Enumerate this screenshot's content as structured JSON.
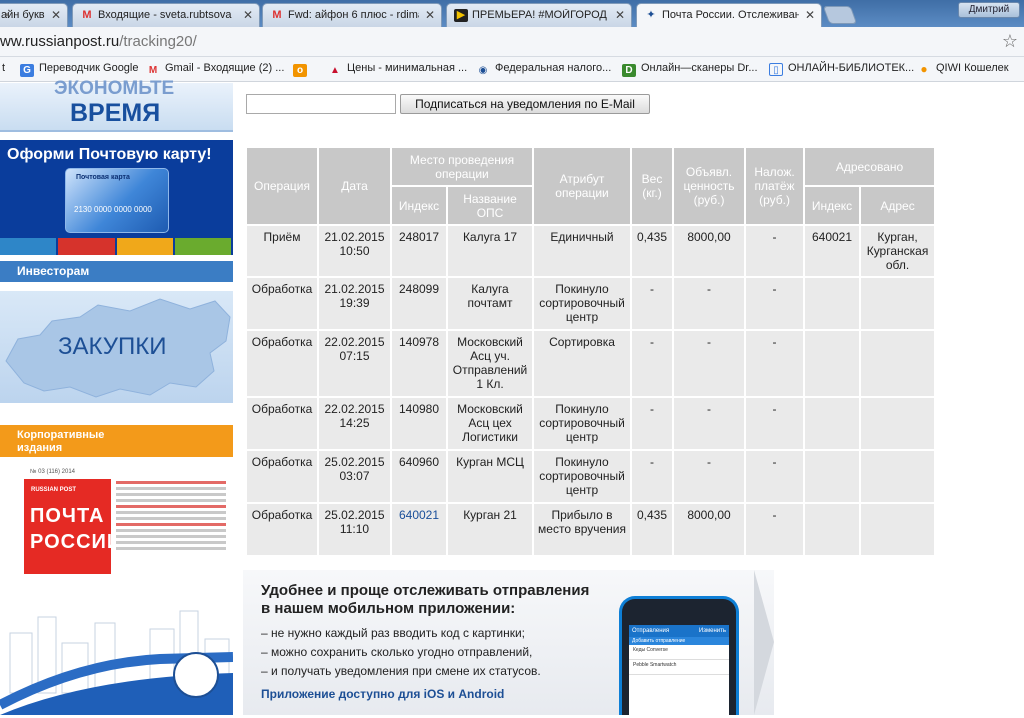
{
  "browser": {
    "tabs": [
      {
        "label": "айн букв",
        "icon": "bookmark-icon",
        "active": false
      },
      {
        "label": "Входящие - sveta.rubtsova",
        "icon": "gmail-icon",
        "active": false
      },
      {
        "label": "Fwd: айфон 6 плюс - rdimas",
        "icon": "gmail-icon",
        "active": false
      },
      {
        "label": "ПРЕМЬЕРА! #МОЙГОРОД -",
        "icon": "play-icon",
        "active": false
      },
      {
        "label": "Почта России. Отслеживан",
        "icon": "eagle-icon",
        "active": true
      }
    ],
    "user": "Дмитрий",
    "url_host": "ww.russianpost.ru",
    "url_path": "/tracking20/",
    "bookmarks": [
      {
        "label": "t",
        "icon": ""
      },
      {
        "label": "Переводчик Google",
        "icon": "translate-icon"
      },
      {
        "label": "Gmail - Входящие (2) ...",
        "icon": "gmail-icon"
      },
      {
        "label": "",
        "icon": "ok-icon"
      },
      {
        "label": "Цены - минимальная ...",
        "icon": "triangle-icon"
      },
      {
        "label": "Федеральная налого...",
        "icon": "emblem-icon"
      },
      {
        "label": "Онлайн—сканеры Dr...",
        "icon": "scanner-icon"
      },
      {
        "label": "ОНЛАЙН-БИБЛИОТЕК...",
        "icon": "library-icon"
      },
      {
        "label": "QIWI Кошелек",
        "icon": "qiwi-icon"
      }
    ]
  },
  "sidebar": {
    "economy_line1": "ЭКОНОМЬТЕ",
    "economy_line2": "ВРЕМЯ",
    "card_promo": "Оформи Почтовую карту!",
    "card_brand": "Почтовая карта",
    "card_number": "2130 0000 0000 0000",
    "investors": "Инвесторам",
    "zakupki": "ЗАКУПКИ",
    "corp_line1": "Корпоративные",
    "corp_line2": "издания",
    "mag_issue": "№ 03 (116) 2014",
    "mag_brand": "RUSSIAN POST",
    "mag_title1": "ПОЧТА",
    "mag_title2": "РОССИИ"
  },
  "subscribe": {
    "input_value": "",
    "button_label": "Подписаться на уведомления по E-Mail"
  },
  "table": {
    "headers": {
      "operation": "Операция",
      "date": "Дата",
      "place": "Место проведения операции",
      "place_index": "Индекс",
      "place_name": "Название ОПС",
      "attribute": "Атрибут операции",
      "weight": "Вес (кг.)",
      "declared": "Объявл. ценность (руб.)",
      "cod": "Налож. платёж (руб.)",
      "addressed": "Адресовано",
      "addr_index": "Индекс",
      "addr_address": "Адрес"
    },
    "rows": [
      {
        "operation": "Приём",
        "date": "21.02.2015",
        "time": "10:50",
        "index": "248017",
        "name": "Калуга 17",
        "attribute": "Единичный",
        "weight": "0,435",
        "declared": "8000,00",
        "cod": "-",
        "addr_index": "640021",
        "addr": "Курган, Курганская обл.",
        "index_link": false
      },
      {
        "operation": "Обработка",
        "date": "21.02.2015",
        "time": "19:39",
        "index": "248099",
        "name": "Калуга почтамт",
        "attribute": "Покинуло сортировочный центр",
        "weight": "-",
        "declared": "-",
        "cod": "-",
        "addr_index": "",
        "addr": "",
        "index_link": false
      },
      {
        "operation": "Обработка",
        "date": "22.02.2015",
        "time": "07:15",
        "index": "140978",
        "name": "Московский Асц уч. Отправлений 1 Кл.",
        "attribute": "Сортировка",
        "weight": "-",
        "declared": "-",
        "cod": "-",
        "addr_index": "",
        "addr": "",
        "index_link": false
      },
      {
        "operation": "Обработка",
        "date": "22.02.2015",
        "time": "14:25",
        "index": "140980",
        "name": "Московский Асц цех Логистики",
        "attribute": "Покинуло сортировочный центр",
        "weight": "-",
        "declared": "-",
        "cod": "-",
        "addr_index": "",
        "addr": "",
        "index_link": false
      },
      {
        "operation": "Обработка",
        "date": "25.02.2015",
        "time": "03:07",
        "index": "640960",
        "name": "Курган МСЦ",
        "attribute": "Покинуло сортировочный центр",
        "weight": "-",
        "declared": "-",
        "cod": "-",
        "addr_index": "",
        "addr": "",
        "index_link": false
      },
      {
        "operation": "Обработка",
        "date": "25.02.2015",
        "time": "11:10",
        "index": "640021",
        "name": "Курган 21",
        "attribute": "Прибыло в место вручения",
        "weight": "0,435",
        "declared": "8000,00",
        "cod": "-",
        "addr_index": "",
        "addr": "",
        "index_link": true
      }
    ]
  },
  "app_promo": {
    "title_line1": "Удобнее и проще отслеживать отправления",
    "title_line2": "в нашем мобильном приложении:",
    "bullets": [
      "– не нужно каждый раз вводить код с картинки;",
      "– можно сохранить сколько угодно отправлений,",
      "– и получать уведомления при смене их статусов."
    ],
    "available": "Приложение доступно для iOS и Android",
    "phone_title": "Отправления",
    "phone_edit": "Изменить",
    "phone_add": "Добавить отправление",
    "phone_item1": "Кеды Converse",
    "phone_item2": "Pebble Smartwatch"
  },
  "colors": {
    "header_bg": "#c8c8c8",
    "cell_bg": "#eaeaea",
    "link": "#1a4f9a",
    "brand_blue": "#0a3d9c",
    "orange": "#f39a1a"
  }
}
